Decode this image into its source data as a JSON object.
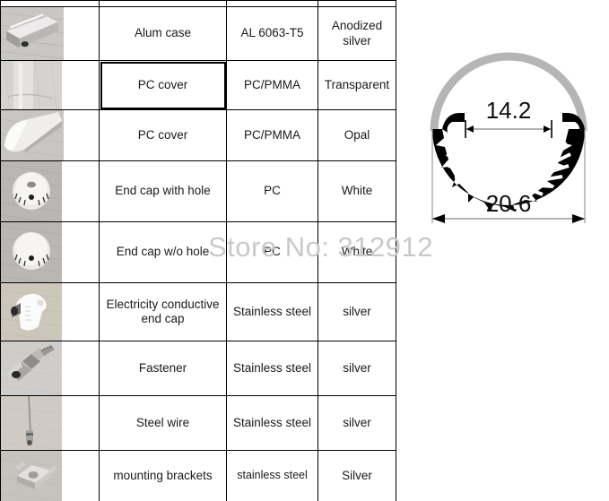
{
  "table": {
    "header_strip": {
      "accent_color": "#f2bc86",
      "plain_color": "#fdfdfa"
    },
    "columns": [
      "image",
      "part_name",
      "material",
      "color"
    ],
    "rows": [
      {
        "thumb": "led-profile-alum-case-photo",
        "name": "Alum case",
        "material": "AL 6063-T5",
        "color": "Anodized silver",
        "selected": false
      },
      {
        "thumb": "pc-cover-transparent-photo",
        "name": "PC cover",
        "material": "PC/PMMA",
        "color": "Transparent",
        "selected": true
      },
      {
        "thumb": "pc-cover-opal-photo",
        "name": "PC cover",
        "material": "PC/PMMA",
        "color": "Opal",
        "selected": false
      },
      {
        "thumb": "end-cap-with-hole-photo",
        "name": "End cap with hole",
        "material": "PC",
        "color": "White",
        "selected": false
      },
      {
        "thumb": "end-cap-without-hole-photo",
        "name": "End cap w/o hole",
        "material": "PC",
        "color": "White",
        "selected": false
      },
      {
        "thumb": "conductive-end-cap-photo",
        "name": "Electricity conductive end cap",
        "material": "Stainless steel",
        "color": "silver",
        "selected": false
      },
      {
        "thumb": "fastener-photo",
        "name": "Fastener",
        "material": "Stainless steel",
        "color": "silver",
        "selected": false
      },
      {
        "thumb": "steel-wire-photo",
        "name": "Steel wire",
        "material": "Stainless steel",
        "color": "silver",
        "selected": false
      },
      {
        "thumb": "mounting-bracket-photo",
        "name": "mounting brackets",
        "material": "stainless steel",
        "color": "Silver",
        "selected": false
      }
    ]
  },
  "watermark": {
    "text": "Store No: 312912",
    "color": "#c9c9c9"
  },
  "drawing": {
    "title": "led-profile-cross-section",
    "inner_width_label": "14.2",
    "outer_width_label": "20.6",
    "body_color": "#000000",
    "cover_color": "#b5b5b5",
    "dimension_line_color": "#9a9a9a"
  }
}
